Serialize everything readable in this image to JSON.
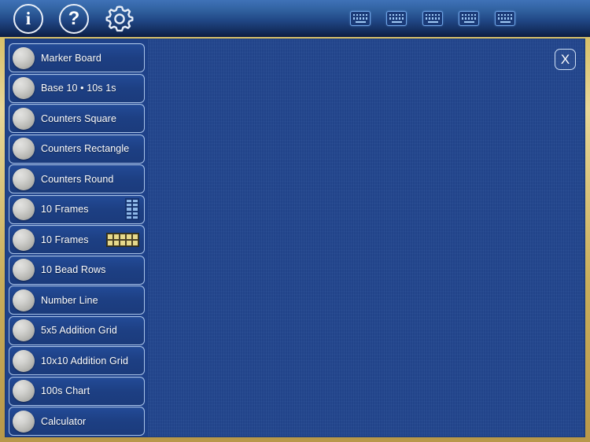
{
  "header": {
    "info_label": "i",
    "help_label": "?",
    "settings_icon": "gear-icon",
    "keyboards": [
      {
        "name": "keyboard-1"
      },
      {
        "name": "keyboard-2"
      },
      {
        "name": "keyboard-3"
      },
      {
        "name": "keyboard-4"
      },
      {
        "name": "keyboard-5"
      }
    ]
  },
  "sidebar": {
    "items": [
      {
        "label": "Marker Board",
        "thumb": "none"
      },
      {
        "label": "Base 10 • 10s 1s",
        "thumb": "none"
      },
      {
        "label": "Counters Square",
        "thumb": "none"
      },
      {
        "label": "Counters Rectangle",
        "thumb": "none"
      },
      {
        "label": "Counters Round",
        "thumb": "none"
      },
      {
        "label": "10 Frames",
        "thumb": "ten-frame-vertical"
      },
      {
        "label": "10 Frames",
        "thumb": "ten-frame-horizontal"
      },
      {
        "label": "10 Bead Rows",
        "thumb": "none"
      },
      {
        "label": "Number Line",
        "thumb": "none"
      },
      {
        "label": "5x5 Addition Grid",
        "thumb": "none"
      },
      {
        "label": "10x10 Addition Grid",
        "thumb": "none"
      },
      {
        "label": "100s Chart",
        "thumb": "none"
      },
      {
        "label": "Calculator",
        "thumb": "none"
      }
    ]
  },
  "content": {
    "close_label": "X"
  },
  "colors": {
    "frame_gold": "#d8c068",
    "panel_blue": "#23478f",
    "sidebar_blue": "#1e4189",
    "header_top": "#3f72b8",
    "header_bottom": "#0b1b42",
    "item_border": "#a9c3e8",
    "accent_white": "#ffffff"
  }
}
